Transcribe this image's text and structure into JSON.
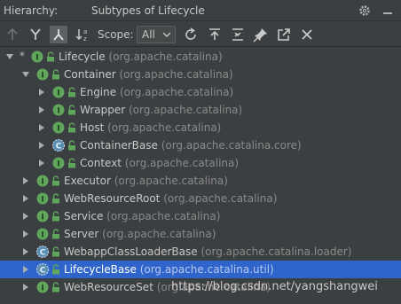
{
  "title": {
    "label": "Hierarchy:",
    "subject": "Subtypes of Lifecycle"
  },
  "toolbar": {
    "scope_label": "Scope:",
    "scope_value": "All"
  },
  "tree": [
    {
      "star": "*",
      "name": "Lifecycle",
      "pkg": " (org.apache.catalina)",
      "kind": "interface",
      "arrow": "down"
    },
    {
      "name": "Container",
      "pkg": " (org.apache.catalina)",
      "kind": "interface",
      "arrow": "down"
    },
    {
      "name": "Engine",
      "pkg": " (org.apache.catalina)",
      "kind": "interface",
      "arrow": "right"
    },
    {
      "name": "Wrapper",
      "pkg": " (org.apache.catalina)",
      "kind": "interface",
      "arrow": "right"
    },
    {
      "name": "Host",
      "pkg": " (org.apache.catalina)",
      "kind": "interface",
      "arrow": "right"
    },
    {
      "name": "ContainerBase",
      "pkg": " (org.apache.catalina.core)",
      "kind": "abstract-class",
      "arrow": "right"
    },
    {
      "name": "Context",
      "pkg": " (org.apache.catalina)",
      "kind": "interface",
      "arrow": "right"
    },
    {
      "name": "Executor",
      "pkg": " (org.apache.catalina)",
      "kind": "interface",
      "arrow": "right"
    },
    {
      "name": "WebResourceRoot",
      "pkg": " (org.apache.catalina)",
      "kind": "interface",
      "arrow": "right"
    },
    {
      "name": "Service",
      "pkg": " (org.apache.catalina)",
      "kind": "interface",
      "arrow": "right"
    },
    {
      "name": "Server",
      "pkg": " (org.apache.catalina)",
      "kind": "interface",
      "arrow": "right"
    },
    {
      "name": "WebappClassLoaderBase",
      "pkg": " (org.apache.catalina.loader)",
      "kind": "abstract-class",
      "arrow": "right"
    },
    {
      "name": "LifecycleBase",
      "pkg": " (org.apache.catalina.util)",
      "kind": "abstract-class",
      "arrow": "right",
      "selected": true
    },
    {
      "name": "WebResourceSet",
      "pkg": " (org.apache.catalina)",
      "kind": "interface",
      "arrow": "right"
    }
  ],
  "watermark": "https://blog.csdn.net/yangshangwei",
  "colors": {
    "interface": "#5fa55a",
    "class": "#3592c4",
    "selection": "#2f65ca"
  }
}
